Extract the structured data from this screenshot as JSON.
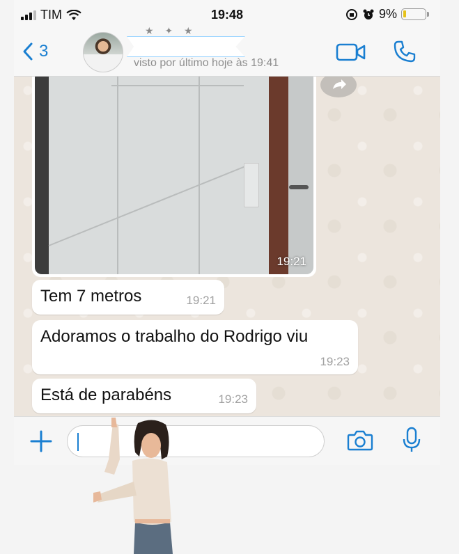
{
  "status_bar": {
    "carrier": "TIM",
    "time": "19:48",
    "battery": "9%",
    "battery_level": 0.09
  },
  "header": {
    "back_count": "3",
    "contact_name": "",
    "last_seen": "visto por último hoje às 19:41"
  },
  "messages": [
    {
      "type": "image",
      "time": "19:21"
    },
    {
      "type": "text",
      "text": "Tem 7 metros",
      "time": "19:21"
    },
    {
      "type": "text",
      "text": "Adoramos o trabalho do Rodrigo viu",
      "time": "19:23"
    },
    {
      "type": "text",
      "text": "Está de parabéns",
      "time": "19:23"
    }
  ],
  "input": {
    "value": ""
  },
  "colors": {
    "accent": "#1a7fd1",
    "chat_background": "#ece5dd",
    "bubble": "#ffffff",
    "meta_text": "#8e8e8e"
  },
  "icons": [
    "back-chevron-icon",
    "video-call-icon",
    "phone-call-icon",
    "forward-icon",
    "plus-icon",
    "sticker-icon",
    "camera-icon",
    "microphone-icon",
    "wifi-icon",
    "alarm-icon",
    "rotation-lock-icon"
  ]
}
